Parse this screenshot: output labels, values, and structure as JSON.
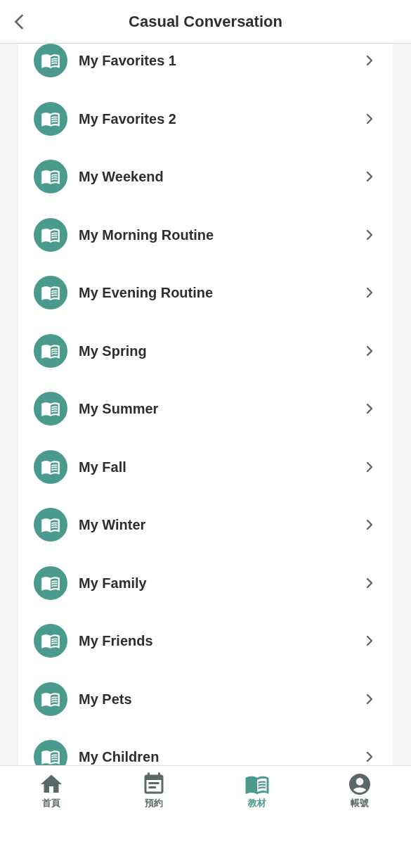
{
  "header": {
    "title": "Casual Conversation"
  },
  "lessons": [
    {
      "title": "My Favorites 1"
    },
    {
      "title": "My Favorites 2"
    },
    {
      "title": "My Weekend"
    },
    {
      "title": "My Morning Routine"
    },
    {
      "title": "My Evening Routine"
    },
    {
      "title": "My Spring"
    },
    {
      "title": "My Summer"
    },
    {
      "title": "My Fall"
    },
    {
      "title": "My Winter"
    },
    {
      "title": "My Family"
    },
    {
      "title": "My Friends"
    },
    {
      "title": "My Pets"
    },
    {
      "title": "My Children"
    }
  ],
  "tab_bar": [
    {
      "kind": "home",
      "label": "首頁",
      "selected": false
    },
    {
      "kind": "booking",
      "label": "預約",
      "selected": false
    },
    {
      "kind": "materials",
      "label": "教材",
      "selected": true
    },
    {
      "kind": "account",
      "label": "帳號",
      "selected": false
    }
  ]
}
